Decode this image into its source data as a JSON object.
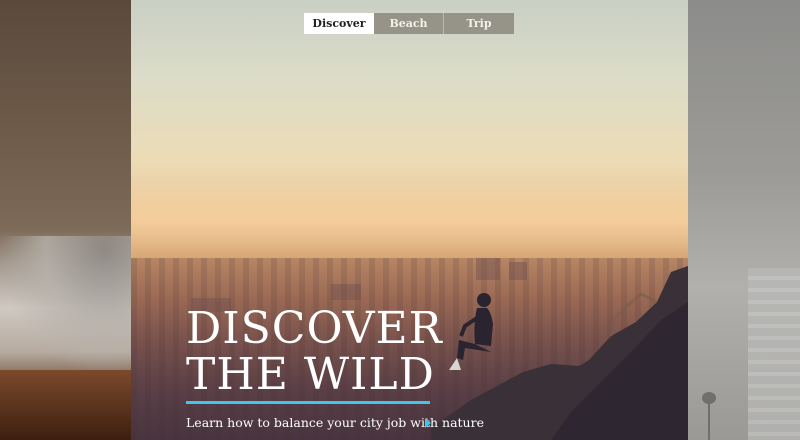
{
  "tabs": [
    {
      "label": "Discover",
      "active": true
    },
    {
      "label": "Beach",
      "active": false
    },
    {
      "label": "Trip",
      "active": false
    }
  ],
  "hero": {
    "headline_line1": "DISCOVER",
    "headline_line2": "THE WILD",
    "tagline": "Learn how to balance your city job with nature"
  },
  "colors": {
    "accent": "#3ec7ea",
    "tab_active_bg": "#ffffff",
    "tab_inactive_bg": "#8c877d"
  },
  "icons": {
    "next": "triangle-right-icon"
  }
}
